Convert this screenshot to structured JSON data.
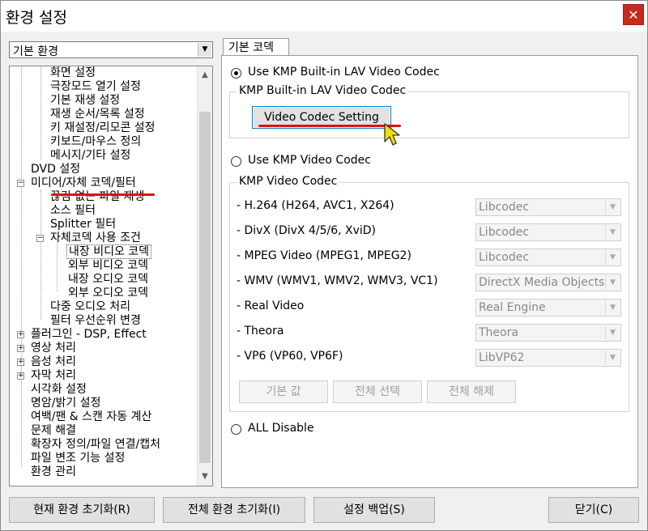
{
  "window": {
    "title": "환경 설정",
    "close_label": "✕"
  },
  "left": {
    "combo_value": "기본 환경",
    "tree": [
      {
        "label": "화면 설정"
      },
      {
        "label": "극장모드 열기  설정"
      },
      {
        "label": "기본 재생 설정"
      },
      {
        "label": "재생 순서/목록 설정"
      },
      {
        "label": "키 재설정/리모콘 설정"
      },
      {
        "label": "키보드/마우스 정의"
      },
      {
        "label": "메시지/기타 설정"
      },
      {
        "label": "DVD 설정"
      },
      {
        "label": "미디어/자체 코덱/필터"
      },
      {
        "label": "끊김 없는 파일 재생"
      },
      {
        "label": "소스 필터"
      },
      {
        "label": "Splitter 필터"
      },
      {
        "label": "자체코덱 사용 조건"
      },
      {
        "label": "내장 비디오 코덱"
      },
      {
        "label": "외부 비디오 코덱"
      },
      {
        "label": "내장 오디오 코덱"
      },
      {
        "label": "외부 오디오 코덱"
      },
      {
        "label": "다중 오디오 처리"
      },
      {
        "label": "필터 우선순위 변경"
      },
      {
        "label": "플러그인 - DSP, Effect"
      },
      {
        "label": "영상 처리"
      },
      {
        "label": "음성 처리"
      },
      {
        "label": "자막 처리"
      },
      {
        "label": "시각화 설정"
      },
      {
        "label": "명암/밝기 설정"
      },
      {
        "label": "여백/팬 & 스캔 자동 계산"
      },
      {
        "label": "문제 해결"
      },
      {
        "label": "확장자 정의/파일 연결/캡처"
      },
      {
        "label": "파일 변조 기능 설정"
      },
      {
        "label": "환경 관리"
      }
    ]
  },
  "right": {
    "tab_label": "기본 코덱",
    "opt_builtin": "Use KMP Built-in LAV Video Codec",
    "group_builtin": "KMP Built-in LAV Video Codec",
    "video_codec_setting": "Video Codec Setting",
    "opt_kmp": "Use KMP Video Codec",
    "group_kmp": "KMP Video Codec",
    "codecs": [
      {
        "name": "- H.264 (H264, AVC1, X264)",
        "value": "Libcodec"
      },
      {
        "name": "- DivX (DivX 4/5/6, XviD)",
        "value": "Libcodec"
      },
      {
        "name": "- MPEG Video (MPEG1, MPEG2)",
        "value": "Libcodec"
      },
      {
        "name": "- WMV (WMV1, WMV2, WMV3, VC1)",
        "value": "DirectX Media Objects"
      },
      {
        "name": "- Real Video",
        "value": "Real Engine"
      },
      {
        "name": "- Theora",
        "value": "Theora"
      },
      {
        "name": "- VP6 (VP60, VP6F)",
        "value": "LibVP62"
      }
    ],
    "btn_default": "기본 값",
    "btn_select_all": "전체 선택",
    "btn_clear_all": "전체 해제",
    "opt_disable": "ALL Disable"
  },
  "bottom": {
    "reset_current": "현재 환경 초기화(R)",
    "reset_all": "전체 환경 초기화(I)",
    "backup": "설정 백업(S)",
    "close": "닫기(C)"
  },
  "colors": {
    "highlight_red": "#e01010",
    "cursor_yellow": "#f5e000"
  }
}
